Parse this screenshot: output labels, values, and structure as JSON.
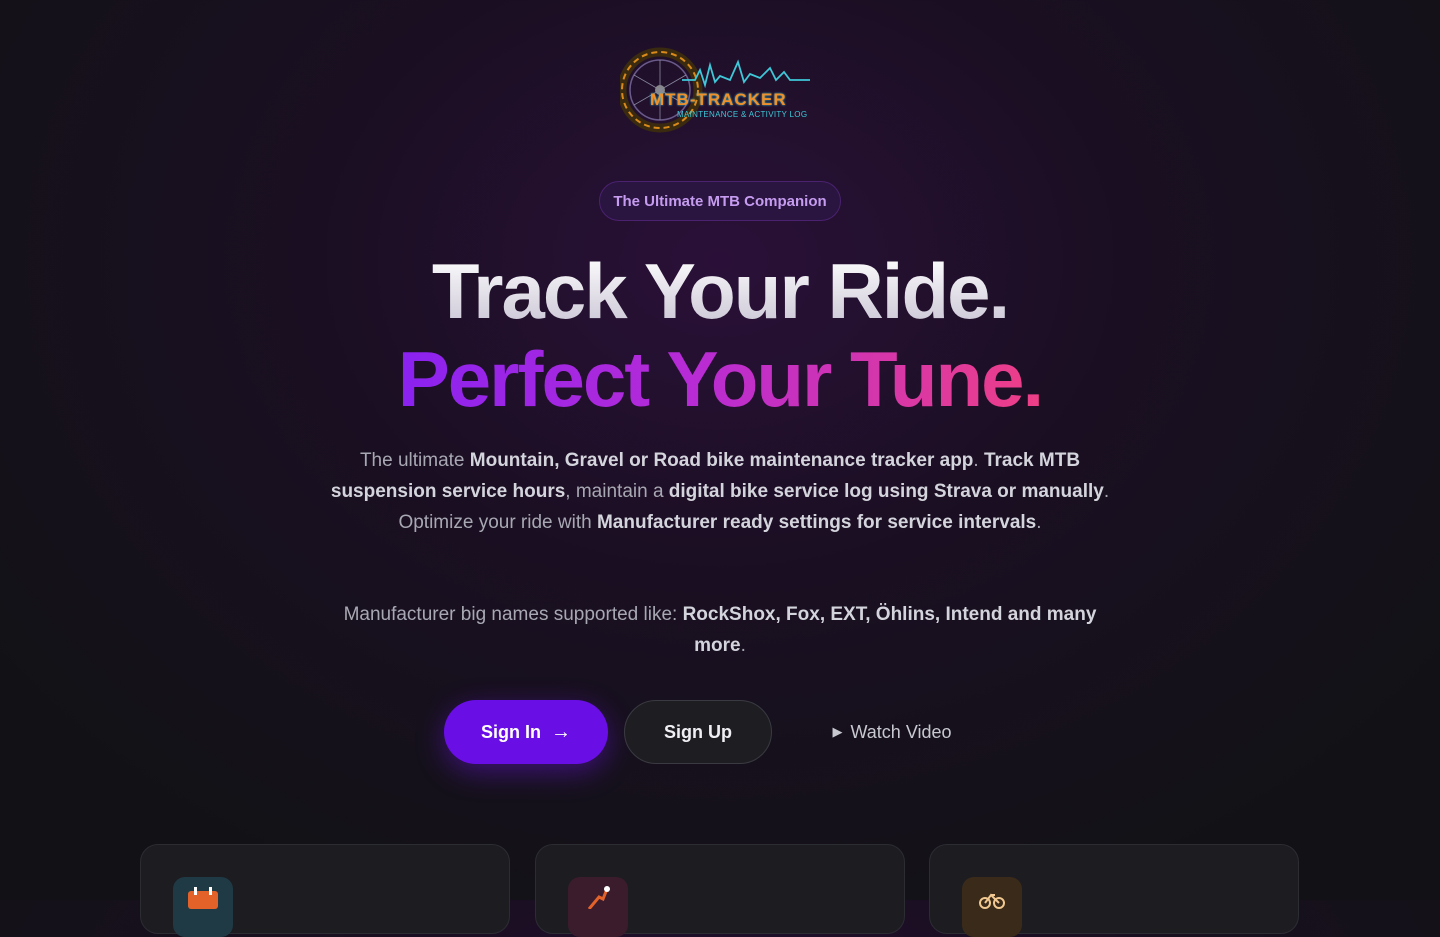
{
  "logo": {
    "title": "MTB-TRACKER",
    "subtitle": "MAINTENANCE & ACTIVITY LOG"
  },
  "badge": "The Ultimate MTB Companion",
  "headline": {
    "line1": "Track Your Ride.",
    "line2": "Perfect Your Tune."
  },
  "description": {
    "p1_a": "The ultimate ",
    "p1_b": "Mountain, Gravel or Road bike maintenance tracker app",
    "p1_c": ". ",
    "p1_d": "Track MTB suspension service hours",
    "p1_e": ", maintain a ",
    "p1_f": "digital bike service log using Strava or manually",
    "p1_g": ". Optimize your ride with ",
    "p1_h": "Manufacturer ready settings for service intervals",
    "p1_i": ".",
    "p2_a": "Manufacturer big names supported like: ",
    "p2_b": "RockShox, Fox, EXT, Öhlins, Intend and many more",
    "p2_c": "."
  },
  "actions": {
    "sign_in": "Sign In",
    "sign_in_arrow": "→",
    "sign_up": "Sign Up",
    "watch_video": "Watch Video",
    "play_glyph": "▶"
  },
  "cards": [
    {
      "icon": "calendar-icon",
      "color": "#1f3a44"
    },
    {
      "icon": "wrench-icon",
      "color": "#3a1c2c"
    },
    {
      "icon": "bike-icon",
      "color": "#3a2a1a"
    }
  ]
}
